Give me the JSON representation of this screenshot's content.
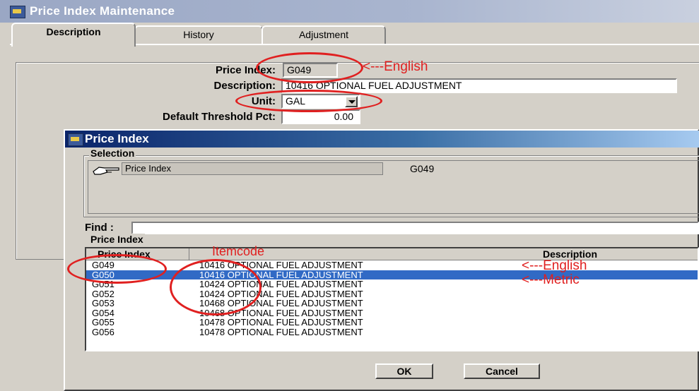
{
  "window": {
    "title": "Price Index Maintenance"
  },
  "tabs": [
    {
      "label": "Description"
    },
    {
      "label": "History"
    },
    {
      "label": "Adjustment"
    }
  ],
  "form": {
    "price_index_label": "Price Index:",
    "price_index_value": "G049",
    "description_label": "Description:",
    "description_value": "10416 OPTIONAL FUEL ADJUSTMENT",
    "unit_label": "Unit:",
    "unit_value": "GAL",
    "threshold_label": "Default Threshold Pct:",
    "threshold_value": "0.00"
  },
  "dialog": {
    "title": "Price Index",
    "selection_group": "Selection",
    "selection_label": "Price Index",
    "selection_value": "G049",
    "find_label": "Find :",
    "find_value": "",
    "list_group": "Price Index",
    "columns": [
      "Price Index",
      "Description"
    ],
    "rows": [
      {
        "code": "G049",
        "desc": "10416 OPTIONAL FUEL ADJUSTMENT",
        "selected": false
      },
      {
        "code": "G050",
        "desc": "10416 OPTIONAL FUEL ADJUSTMENT",
        "selected": true
      },
      {
        "code": "G051",
        "desc": "10424 OPTIONAL FUEL ADJUSTMENT",
        "selected": false
      },
      {
        "code": "G052",
        "desc": "10424 OPTIONAL FUEL ADJUSTMENT",
        "selected": false
      },
      {
        "code": "G053",
        "desc": "10468 OPTIONAL FUEL ADJUSTMENT",
        "selected": false
      },
      {
        "code": "G054",
        "desc": "10468 OPTIONAL FUEL ADJUSTMENT",
        "selected": false
      },
      {
        "code": "G055",
        "desc": "10478 OPTIONAL FUEL ADJUSTMENT",
        "selected": false
      },
      {
        "code": "G056",
        "desc": "10478 OPTIONAL FUEL ADJUSTMENT",
        "selected": false
      }
    ],
    "ok_label": "OK",
    "cancel_label": "Cancel"
  },
  "annotations": {
    "english_top": "<---English",
    "itemcode": "Itemcode",
    "english_row": "<---English",
    "metric_row": "<---Metric"
  },
  "colors": {
    "annotation": "#e02020",
    "selection": "#316ac5",
    "title_active": "#0a246a"
  },
  "icons": {
    "app": "app-window-icon",
    "pointer": "pointing-hand-icon",
    "dropdown": "chevron-down-icon"
  }
}
